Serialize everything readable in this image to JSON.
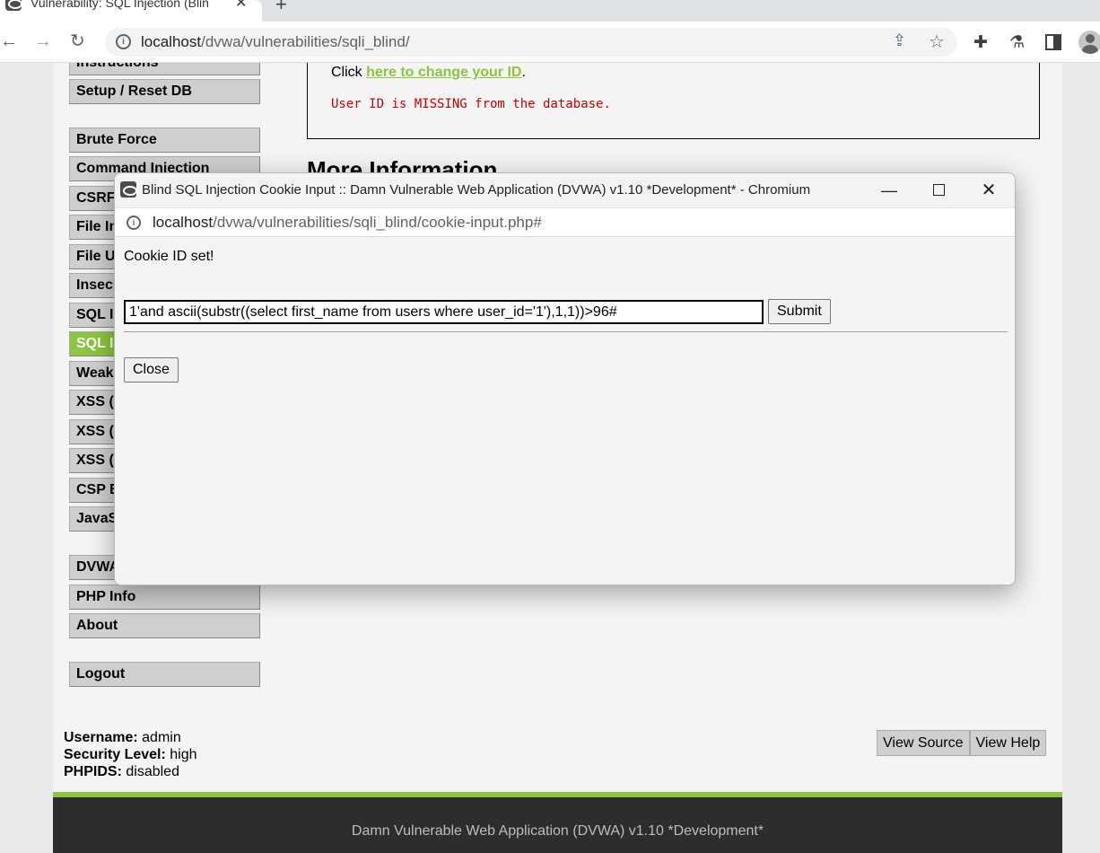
{
  "browser": {
    "tab_title": "Vulnerability: SQL Injection (Blin",
    "tab_close": "✕",
    "new_tab": "+",
    "url_host": "localhost",
    "url_path": "/dvwa/vulnerabilities/sqli_blind/"
  },
  "sidebar": {
    "items": [
      {
        "label": "Instructions"
      },
      {
        "label": "Setup / Reset DB"
      },
      {
        "label": "Brute Force"
      },
      {
        "label": "Command Injection"
      },
      {
        "label": "CSRF"
      },
      {
        "label": "File Inclusion"
      },
      {
        "label": "File Upload"
      },
      {
        "label": "Insecure CAPTCHA"
      },
      {
        "label": "SQL Injection"
      },
      {
        "label": "SQL Injection (Blind)"
      },
      {
        "label": "Weak Session IDs"
      },
      {
        "label": "XSS (DOM)"
      },
      {
        "label": "XSS (Reflected)"
      },
      {
        "label": "XSS (Stored)"
      },
      {
        "label": "CSP Bypass"
      },
      {
        "label": "JavaScript"
      },
      {
        "label": "DVWA Security"
      },
      {
        "label": "PHP Info"
      },
      {
        "label": "About"
      },
      {
        "label": "Logout"
      }
    ]
  },
  "main": {
    "click_prefix": "Click ",
    "change_id_link": "here to change your ID",
    "click_suffix": ".",
    "missing_message": "User ID is MISSING from the database.",
    "more_info_heading": "More Information"
  },
  "status": {
    "username_label": "Username:",
    "username": "admin",
    "security_label": "Security Level:",
    "security": "high",
    "phpids_label": "PHPIDS:",
    "phpids": "disabled",
    "view_source": "View Source",
    "view_help": "View Help"
  },
  "footer": {
    "text": "Damn Vulnerable Web Application (DVWA) v1.10 *Development*"
  },
  "popup": {
    "title": "Blind SQL Injection Cookie Input :: Damn Vulnerable Web Application (DVWA) v1.10 *Development* - Chromium",
    "url_host": "localhost",
    "url_path": "/dvwa/vulnerabilities/sqli_blind/cookie-input.php#",
    "message": "Cookie ID set!",
    "input_value": "1'and ascii(substr((select first_name from users where user_id='1'),1,1))>96#",
    "submit_label": "Submit",
    "close_label": "Close"
  },
  "colors": {
    "accent_green": "#8cc63f",
    "error_red": "#cc0000",
    "footer_bg": "#2d2d2d"
  }
}
